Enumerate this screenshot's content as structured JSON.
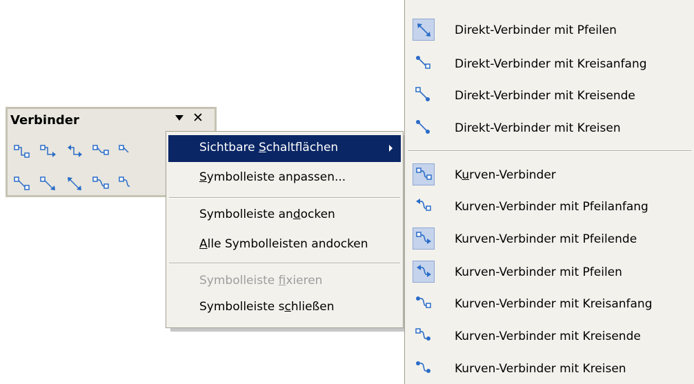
{
  "toolbar": {
    "title": "Verbinder",
    "menu_arrow_icon": "triangle-down-icon",
    "close_glyph": "✕"
  },
  "context_menu": {
    "items": [
      {
        "pre": "Sichtbare ",
        "acc": "S",
        "post": "chaltflächen",
        "selected": true,
        "submenu": true
      },
      {
        "pre": "",
        "acc": "S",
        "post": "ymbolleiste anpassen..."
      },
      {
        "pre": "Symbolleiste an",
        "acc": "d",
        "post": "ocken"
      },
      {
        "pre": "",
        "acc": "A",
        "post": "lle Symbolleisten andocken"
      },
      {
        "pre": "Symbolleiste ",
        "acc": "f",
        "post": "ixieren",
        "disabled": true
      },
      {
        "pre": "Symbolleiste s",
        "acc": "c",
        "post": "hließen"
      }
    ]
  },
  "submenu": {
    "items": [
      {
        "label": "Direkt-Verbinder mit Pfeilen",
        "icon": "direct-connector-arrows-icon",
        "checked": true
      },
      {
        "label": "Direkt-Verbinder mit Kreisanfang",
        "icon": "direct-connector-circle-start-icon",
        "checked": false
      },
      {
        "label": "Direkt-Verbinder mit Kreisende",
        "icon": "direct-connector-circle-end-icon",
        "checked": false
      },
      {
        "label": "Direkt-Verbinder mit Kreisen",
        "icon": "direct-connector-circles-icon",
        "checked": false
      },
      {
        "pre": "K",
        "acc": "u",
        "post": "rven-Verbinder",
        "icon": "curved-connector-icon",
        "checked": true
      },
      {
        "label": "Kurven-Verbinder mit Pfeilanfang",
        "icon": "curved-connector-arrow-start-icon",
        "checked": false
      },
      {
        "label": "Kurven-Verbinder mit Pfeilende",
        "icon": "curved-connector-arrow-end-icon",
        "checked": true
      },
      {
        "label": "Kurven-Verbinder mit Pfeilen",
        "icon": "curved-connector-arrows-icon",
        "checked": true
      },
      {
        "label": "Kurven-Verbinder mit Kreisanfang",
        "icon": "curved-connector-circle-start-icon",
        "checked": false
      },
      {
        "label": "Kurven-Verbinder mit Kreisende",
        "icon": "curved-connector-circle-end-icon",
        "checked": false
      },
      {
        "label": "Kurven-Verbinder mit Kreisen",
        "icon": "curved-connector-circles-icon",
        "checked": false
      }
    ]
  },
  "colors": {
    "selection": "#0a2665",
    "icon_blue": "#2a6cc8",
    "toolbar_bg": "#e8e6de",
    "menu_bg": "#f2f1ec"
  }
}
